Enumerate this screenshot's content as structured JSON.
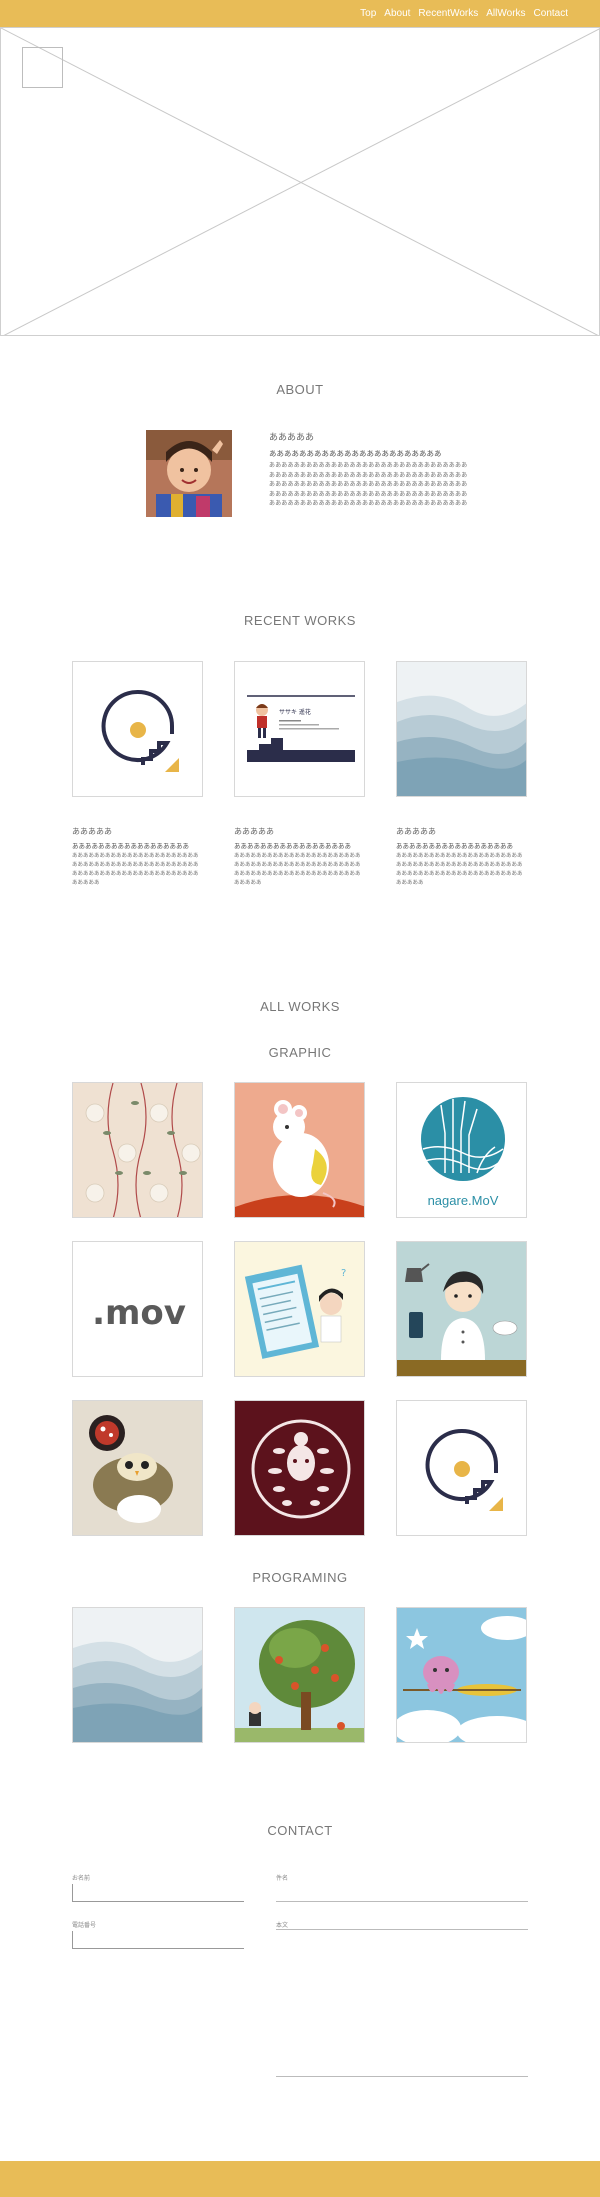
{
  "nav": {
    "items": [
      "Top",
      "About",
      "RecentWorks",
      "AllWorks",
      "Contact"
    ]
  },
  "about": {
    "heading": "ABOUT",
    "name": "あああああ",
    "lead": "あああああああああああああああああああああああ",
    "body": "ああああああああああああああああああああああああああああああああああああああああああああああああああああああああああああああああああああああああああああああああああああああああああああああああああああああああああああああああああああああああああああああああああああああああああああああああああああああああああああああああ"
  },
  "recent": {
    "heading": "RECENT WORKS",
    "cards": [
      {
        "title": "あああああ",
        "lead": "ああああああああああああああああああ",
        "body": "ああああああああああああああああああああああああああああああああああああああああああああああああああああああああああああああああああああああああああ"
      },
      {
        "title": "あああああ",
        "lead": "ああああああああああああああああああ",
        "body": "ああああああああああああああああああああああああああああああああああああああああああああああああああああああああああああああああああああああああああ"
      },
      {
        "title": "あああああ",
        "lead": "ああああああああああああああああああ",
        "body": "ああああああああああああああああああああああああああああああああああああああああああああああああああああああああああああああああああああああああああ"
      }
    ]
  },
  "allworks": {
    "heading": "ALL WORKS",
    "graphic_heading": "GRAPHIC",
    "programing_heading": "PROGRAMING",
    "nagare_caption": "nagare.MoV",
    "mov_caption": ".mov"
  },
  "contact": {
    "heading": "CONTACT",
    "label_1": "お名前",
    "label_2": "件名",
    "label_3": "電話番号",
    "label_4": "本文"
  },
  "colors": {
    "accent": "#e8bc57"
  }
}
